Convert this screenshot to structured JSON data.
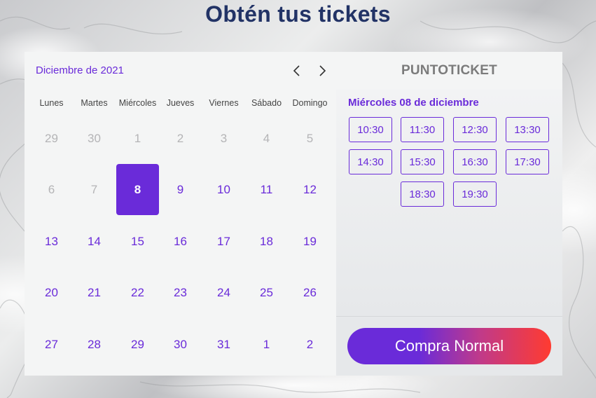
{
  "page": {
    "title": "Obtén tus tickets"
  },
  "calendar": {
    "month_label": "Diciembre de 2021",
    "weekdays": [
      "Lunes",
      "Martes",
      "Miércoles",
      "Jueves",
      "Viernes",
      "Sábado",
      "Domingo"
    ],
    "weeks": [
      [
        {
          "d": "29",
          "muted": true
        },
        {
          "d": "30",
          "muted": true
        },
        {
          "d": "1",
          "muted": true
        },
        {
          "d": "2",
          "muted": true
        },
        {
          "d": "3",
          "muted": true
        },
        {
          "d": "4",
          "muted": true
        },
        {
          "d": "5",
          "muted": true
        }
      ],
      [
        {
          "d": "6",
          "muted": true
        },
        {
          "d": "7",
          "muted": true
        },
        {
          "d": "8",
          "selected": true
        },
        {
          "d": "9"
        },
        {
          "d": "10"
        },
        {
          "d": "11"
        },
        {
          "d": "12"
        }
      ],
      [
        {
          "d": "13"
        },
        {
          "d": "14"
        },
        {
          "d": "15"
        },
        {
          "d": "16"
        },
        {
          "d": "17"
        },
        {
          "d": "18"
        },
        {
          "d": "19"
        }
      ],
      [
        {
          "d": "20"
        },
        {
          "d": "21"
        },
        {
          "d": "22"
        },
        {
          "d": "23"
        },
        {
          "d": "24"
        },
        {
          "d": "25"
        },
        {
          "d": "26"
        }
      ],
      [
        {
          "d": "27"
        },
        {
          "d": "28"
        },
        {
          "d": "29"
        },
        {
          "d": "30"
        },
        {
          "d": "31"
        },
        {
          "d": "1"
        },
        {
          "d": "2"
        }
      ]
    ]
  },
  "brand": {
    "logo_text": "PUNTOTICKET"
  },
  "schedule": {
    "selected_date": "Miércoles 08 de diciembre",
    "times": [
      "10:30",
      "11:30",
      "12:30",
      "13:30",
      "14:30",
      "15:30",
      "16:30",
      "17:30",
      "18:30",
      "19:30"
    ]
  },
  "purchase": {
    "button_label": "Compra Normal"
  },
  "colors": {
    "accent": "#6a2bd9",
    "title": "#223366",
    "muted": "#b4b4b6",
    "gradient_end": "#ff3b30"
  }
}
